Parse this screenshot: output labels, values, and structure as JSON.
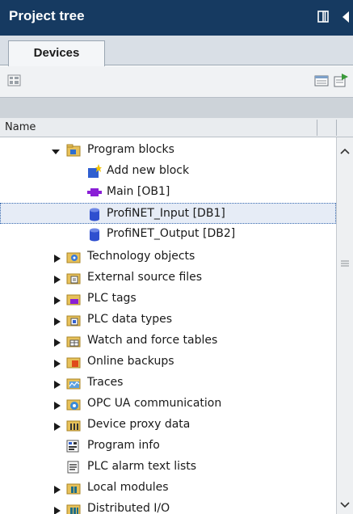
{
  "panel": {
    "title": "Project tree",
    "title_bg": "#163a61"
  },
  "tabs": [
    {
      "label": "Devices",
      "active": true
    }
  ],
  "toolbar": {
    "left_icons": [
      "overview-icon"
    ],
    "right_icons": [
      "table-view-icon",
      "export-icon"
    ]
  },
  "header": {
    "name_column": "Name"
  },
  "tree": {
    "items": [
      {
        "label": "Program blocks",
        "expander": "expanded",
        "icon": "folder-blocks-icon"
      },
      {
        "label": "Add new block",
        "expander": "none",
        "icon": "add-block-icon"
      },
      {
        "label": "Main [OB1]",
        "expander": "none",
        "icon": "ob-block-icon"
      },
      {
        "label": "ProfiNET_Input [DB1]",
        "expander": "none",
        "icon": "db-block-icon",
        "selected": true
      },
      {
        "label": "ProfiNET_Output [DB2]",
        "expander": "none",
        "icon": "db-block-icon"
      },
      {
        "label": "Technology objects",
        "expander": "collapsed",
        "icon": "technology-objects-icon"
      },
      {
        "label": "External source files",
        "expander": "collapsed",
        "icon": "external-source-icon"
      },
      {
        "label": "PLC tags",
        "expander": "collapsed",
        "icon": "plc-tags-icon"
      },
      {
        "label": "PLC data types",
        "expander": "collapsed",
        "icon": "plc-data-types-icon"
      },
      {
        "label": "Watch and force tables",
        "expander": "collapsed",
        "icon": "watch-tables-icon"
      },
      {
        "label": "Online backups",
        "expander": "collapsed",
        "icon": "online-backups-icon"
      },
      {
        "label": "Traces",
        "expander": "collapsed",
        "icon": "traces-icon"
      },
      {
        "label": "OPC UA communication",
        "expander": "collapsed",
        "icon": "opc-ua-icon"
      },
      {
        "label": "Device proxy data",
        "expander": "collapsed",
        "icon": "device-proxy-icon"
      },
      {
        "label": "Program info",
        "expander": "none",
        "icon": "program-info-icon"
      },
      {
        "label": "PLC alarm text lists",
        "expander": "none",
        "icon": "alarm-text-icon"
      },
      {
        "label": "Local modules",
        "expander": "collapsed",
        "icon": "local-modules-icon"
      },
      {
        "label": "Distributed I/O",
        "expander": "collapsed",
        "icon": "distributed-io-icon"
      }
    ]
  },
  "colors": {
    "selection_bg": "#e6ecf6",
    "selection_border": "#3a6bb0"
  }
}
